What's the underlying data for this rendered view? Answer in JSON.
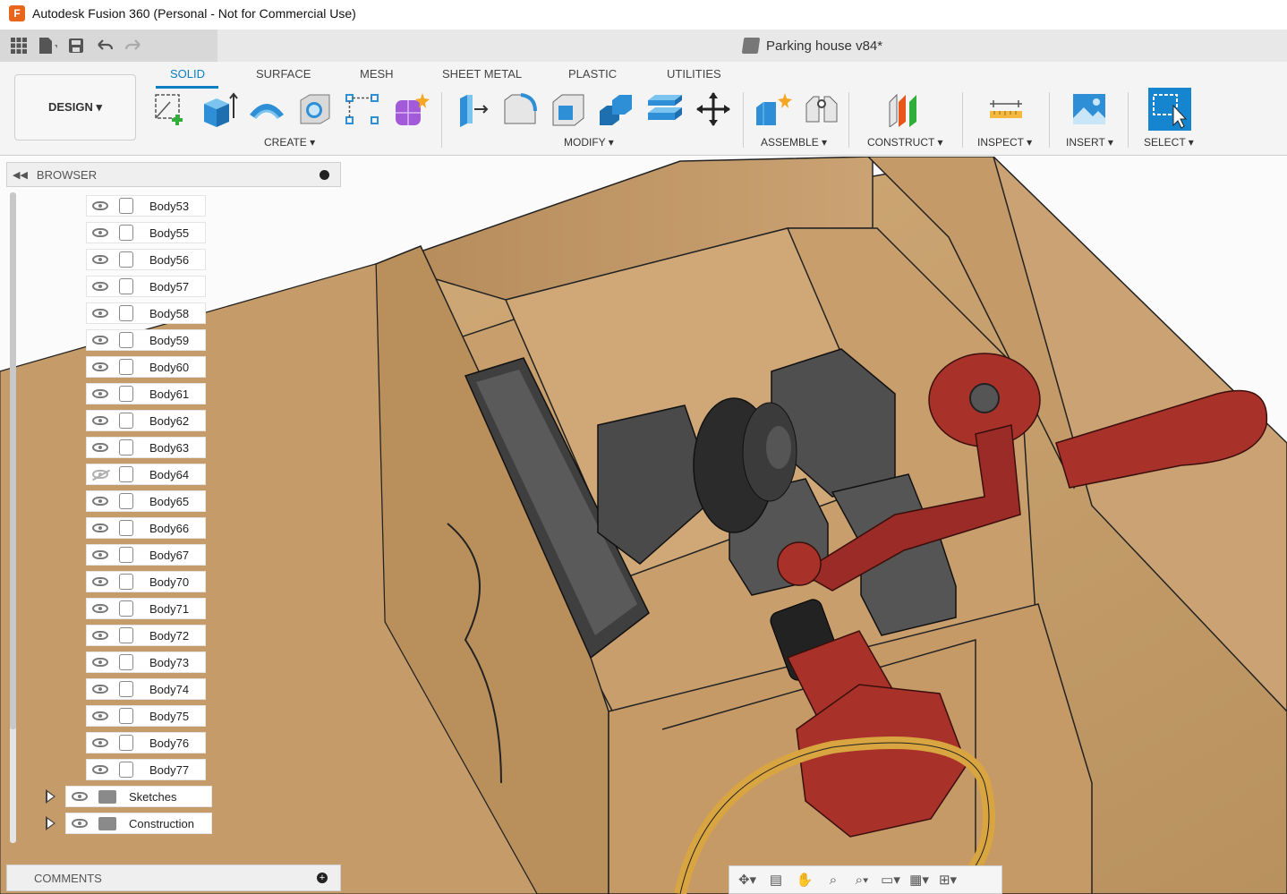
{
  "window": {
    "title": "Autodesk Fusion 360 (Personal - Not for Commercial Use)",
    "logo": "F"
  },
  "quick_access": {
    "icons": [
      "grid-icon",
      "file-icon",
      "save-icon",
      "undo-icon",
      "redo-icon"
    ],
    "document_title": "Parking house v84*"
  },
  "workspace": {
    "label": "DESIGN ▾"
  },
  "tabs": [
    {
      "label": "SOLID",
      "active": true
    },
    {
      "label": "SURFACE"
    },
    {
      "label": "MESH"
    },
    {
      "label": "SHEET METAL"
    },
    {
      "label": "PLASTIC"
    },
    {
      "label": "UTILITIES"
    }
  ],
  "groups": {
    "create": "CREATE ▾",
    "modify": "MODIFY ▾",
    "assemble": "ASSEMBLE ▾",
    "construct": "CONSTRUCT ▾",
    "inspect": "INSPECT ▾",
    "insert": "INSERT ▾",
    "select": "SELECT ▾"
  },
  "browser": {
    "title": "BROWSER",
    "bodies": [
      {
        "label": "Body53",
        "visible": true
      },
      {
        "label": "Body55",
        "visible": true
      },
      {
        "label": "Body56",
        "visible": true
      },
      {
        "label": "Body57",
        "visible": true
      },
      {
        "label": "Body58",
        "visible": true
      },
      {
        "label": "Body59",
        "visible": true
      },
      {
        "label": "Body60",
        "visible": true
      },
      {
        "label": "Body61",
        "visible": true
      },
      {
        "label": "Body62",
        "visible": true
      },
      {
        "label": "Body63",
        "visible": true
      },
      {
        "label": "Body64",
        "visible": false
      },
      {
        "label": "Body65",
        "visible": true
      },
      {
        "label": "Body66",
        "visible": true
      },
      {
        "label": "Body67",
        "visible": true
      },
      {
        "label": "Body70",
        "visible": true
      },
      {
        "label": "Body71",
        "visible": true
      },
      {
        "label": "Body72",
        "visible": true
      },
      {
        "label": "Body73",
        "visible": true
      },
      {
        "label": "Body74",
        "visible": true
      },
      {
        "label": "Body75",
        "visible": true
      },
      {
        "label": "Body76",
        "visible": true
      },
      {
        "label": "Body77",
        "visible": true
      }
    ],
    "folders": [
      {
        "label": "Sketches"
      },
      {
        "label": "Construction"
      }
    ]
  },
  "comments": {
    "title": "COMMENTS"
  },
  "colors": {
    "accent": "#0a7ec2",
    "wood": "#c8a272",
    "wood_dark": "#a57e50",
    "red_part": "#9b2b26",
    "gray_part": "#4a4a4a"
  }
}
